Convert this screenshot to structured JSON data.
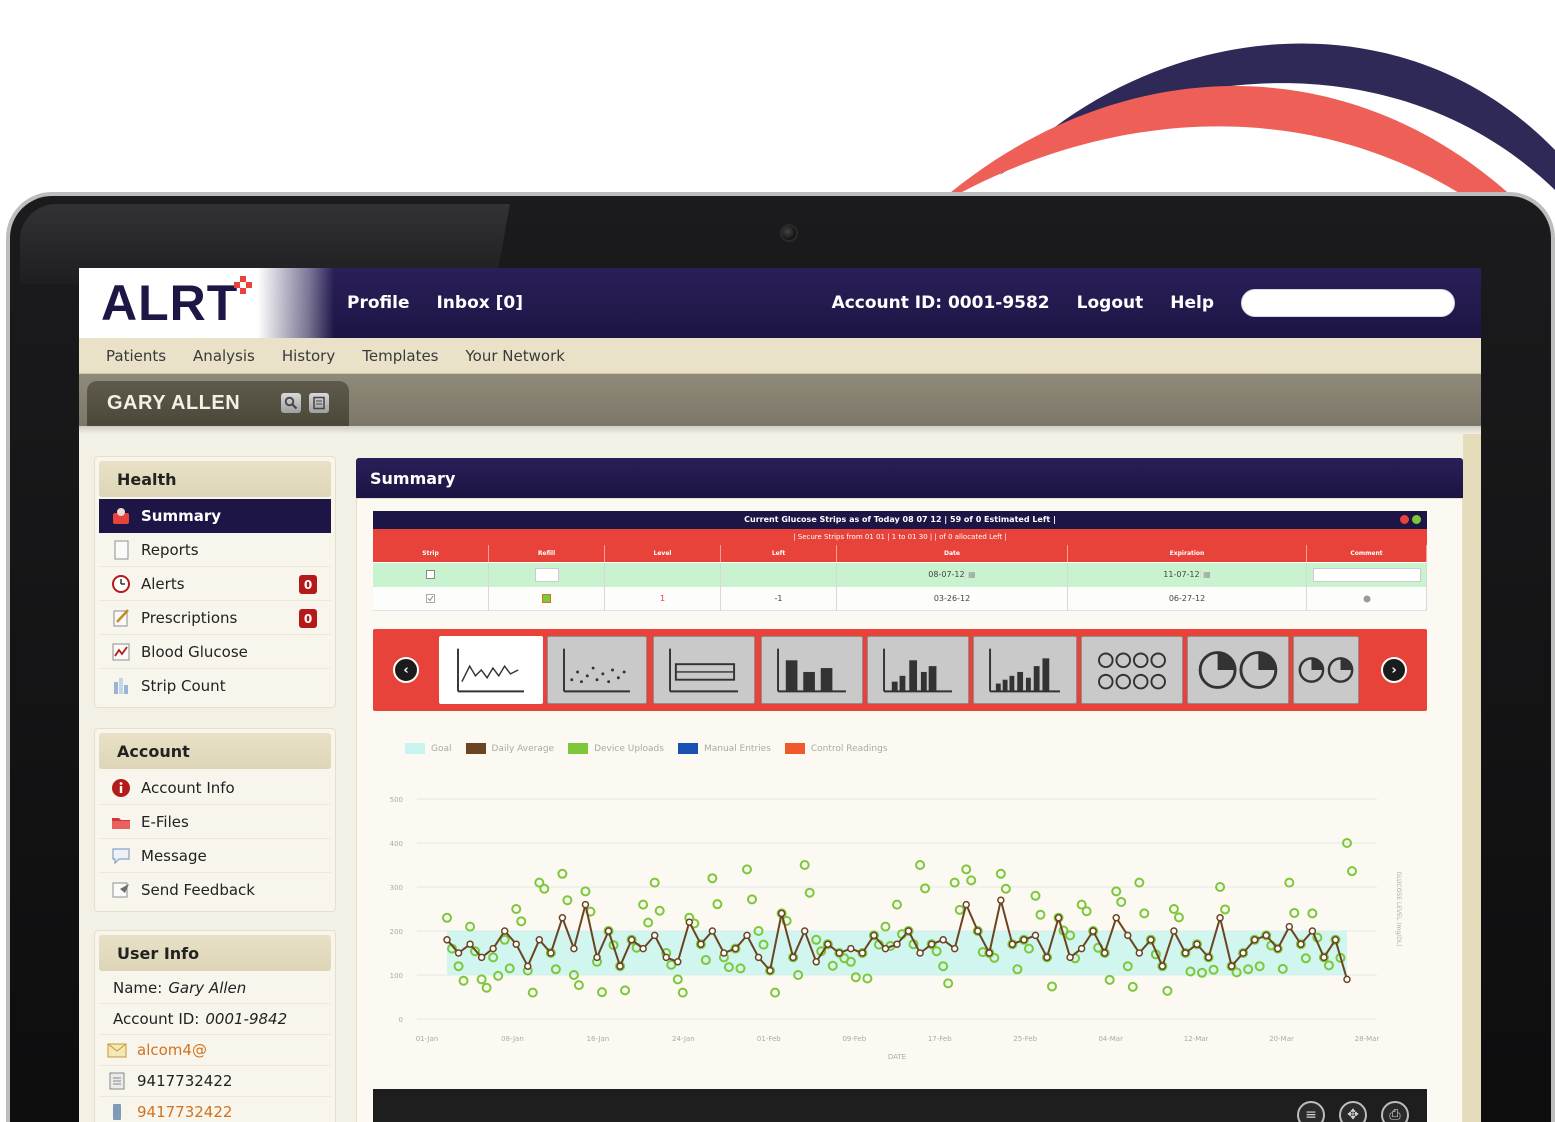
{
  "brand": {
    "logo": "ALRT",
    "accent_color": "#e8433a",
    "nav_color": "#1d1545"
  },
  "topnav": {
    "profile": "Profile",
    "inbox": "Inbox [0]",
    "account_id": "Account ID: 0001-9582",
    "logout": "Logout",
    "help": "Help",
    "search_value": ""
  },
  "subnav": [
    "Patients",
    "Analysis",
    "History",
    "Templates",
    "Your Network"
  ],
  "patient": {
    "name": "GARY ALLEN",
    "icons": [
      "search-icon",
      "notes-icon"
    ]
  },
  "sidebar": {
    "health": {
      "title": "Health",
      "items": [
        {
          "label": "Summary",
          "icon": "summary-icon",
          "active": true
        },
        {
          "label": "Reports",
          "icon": "reports-icon"
        },
        {
          "label": "Alerts",
          "icon": "alerts-icon",
          "badge": "0"
        },
        {
          "label": "Prescriptions",
          "icon": "prescriptions-icon",
          "badge": "0"
        },
        {
          "label": "Blood Glucose",
          "icon": "blood-glucose-icon"
        },
        {
          "label": "Strip Count",
          "icon": "strip-count-icon"
        }
      ]
    },
    "account": {
      "title": "Account",
      "items": [
        {
          "label": "Account Info",
          "icon": "account-info-icon"
        },
        {
          "label": "E-Files",
          "icon": "efiles-icon"
        },
        {
          "label": "Message",
          "icon": "message-icon"
        },
        {
          "label": "Send Feedback",
          "icon": "feedback-icon"
        }
      ]
    },
    "user_info": {
      "title": "User Info",
      "name_label": "Name:",
      "name_value": "Gary Allen",
      "account_label": "Account ID:",
      "account_value": "0001-9842",
      "email": "alcom4@",
      "phone": "9417732422",
      "phone2": "9417732422"
    }
  },
  "main": {
    "title": "Summary",
    "strip_table": {
      "title": "Current Glucose Strips as of Today 08 07 12 | 59 of 0 Estimated Left |",
      "subtitle": "| Secure Strips from 01 01 | 1 to 01 30 | | of 0 allocated Left |",
      "columns": [
        "Strip",
        "Refill",
        "Level",
        "Left",
        "Date",
        "Expiration",
        "Comment"
      ],
      "rows": [
        [
          "",
          "",
          "",
          "",
          "08-07-12",
          "11-07-12",
          ""
        ],
        [
          "",
          "",
          "1",
          "-1",
          "03-26-12",
          "06-27-12",
          ""
        ]
      ]
    },
    "chart_types": [
      "line-chart-icon",
      "scatter-chart-icon",
      "box-chart-icon",
      "bar-chart-icon",
      "histogram-icon",
      "column-chart-icon",
      "dots-chart-icon",
      "pie-chart-icon",
      "pie-small-chart-icon"
    ],
    "legend": [
      {
        "label": "Goal",
        "color": "#c7f4ee"
      },
      {
        "label": "Daily Average",
        "color": "#6b4421"
      },
      {
        "label": "Device Uploads",
        "color": "#7cc83a"
      },
      {
        "label": "Manual Entries",
        "color": "#1c4fb4"
      },
      {
        "label": "Control Readings",
        "color": "#f0592b"
      }
    ],
    "footer_icons": [
      "list-icon",
      "expand-icon",
      "print-icon"
    ]
  },
  "chart_data": {
    "type": "line",
    "title": "",
    "xlabel": "DATE",
    "ylabel": "GLUCOSE LEVEL (mg/DL)",
    "ylim": [
      0,
      500
    ],
    "yticks": [
      0,
      100,
      200,
      300,
      400,
      500
    ],
    "xticks": [
      "01-Jan",
      "08-Jan",
      "16-Jan",
      "24-Jan",
      "01-Feb",
      "09-Feb",
      "17-Feb",
      "25-Feb",
      "04-Mar",
      "12-Mar",
      "20-Mar",
      "28-Mar"
    ],
    "goal_band": [
      100,
      200
    ],
    "series": [
      {
        "name": "Daily Average",
        "color": "#6b4421",
        "values": [
          180,
          150,
          170,
          140,
          160,
          200,
          170,
          120,
          180,
          150,
          230,
          160,
          260,
          140,
          200,
          120,
          180,
          160,
          190,
          140,
          130,
          220,
          170,
          200,
          150,
          160,
          190,
          140,
          110,
          240,
          140,
          200,
          130,
          170,
          150,
          160,
          150,
          190,
          160,
          170,
          200,
          150,
          170,
          180,
          160,
          260,
          200,
          150,
          270,
          170,
          180,
          190,
          140,
          230,
          140,
          160,
          200,
          150,
          230,
          190,
          150,
          180,
          120,
          200,
          150,
          170,
          140,
          230,
          120,
          150,
          180,
          190,
          160,
          210,
          170,
          200,
          140,
          180,
          90
        ]
      },
      {
        "name": "Device Uploads",
        "color": "#7cc83a",
        "values": [
          230,
          120,
          210,
          90,
          140,
          180,
          250,
          110,
          310,
          150,
          330,
          100,
          290,
          130,
          200,
          120,
          180,
          260,
          310,
          150,
          90,
          230,
          170,
          320,
          140,
          160,
          340,
          200,
          110,
          240,
          140,
          350,
          180,
          170,
          150,
          130,
          150,
          190,
          210,
          260,
          200,
          350,
          170,
          120,
          310,
          340,
          200,
          150,
          330,
          170,
          180,
          280,
          140,
          230,
          190,
          260,
          200,
          150,
          290,
          120,
          310,
          180,
          120,
          250,
          150,
          170,
          140,
          300,
          120,
          150,
          180,
          190,
          160,
          310,
          170,
          240,
          140,
          180,
          400
        ]
      }
    ]
  }
}
